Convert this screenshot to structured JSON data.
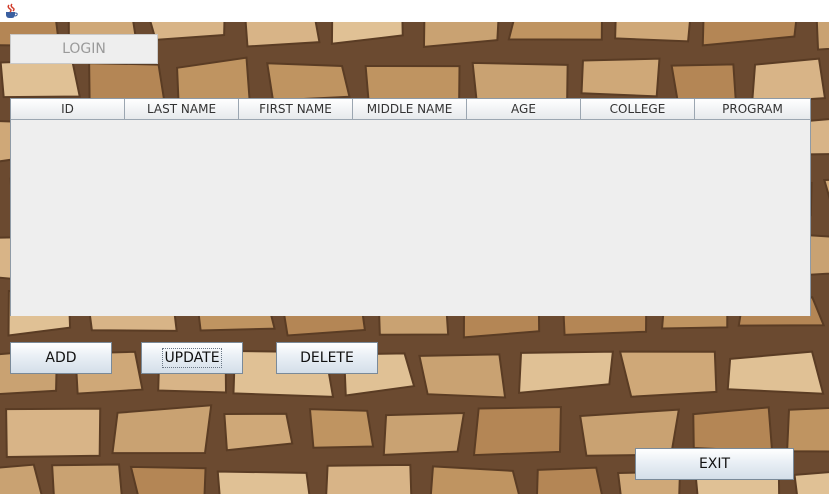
{
  "window": {
    "icon": "java-cup-icon"
  },
  "toolbar": {
    "login_label": "LOGIN"
  },
  "table": {
    "columns": [
      "ID",
      "LAST NAME",
      "FIRST NAME",
      "MIDDLE NAME",
      "AGE",
      "COLLEGE",
      "PROGRAM"
    ],
    "rows": []
  },
  "actions": {
    "add_label": "ADD",
    "update_label": "UPDATE",
    "delete_label": "DELETE",
    "exit_label": "EXIT"
  }
}
